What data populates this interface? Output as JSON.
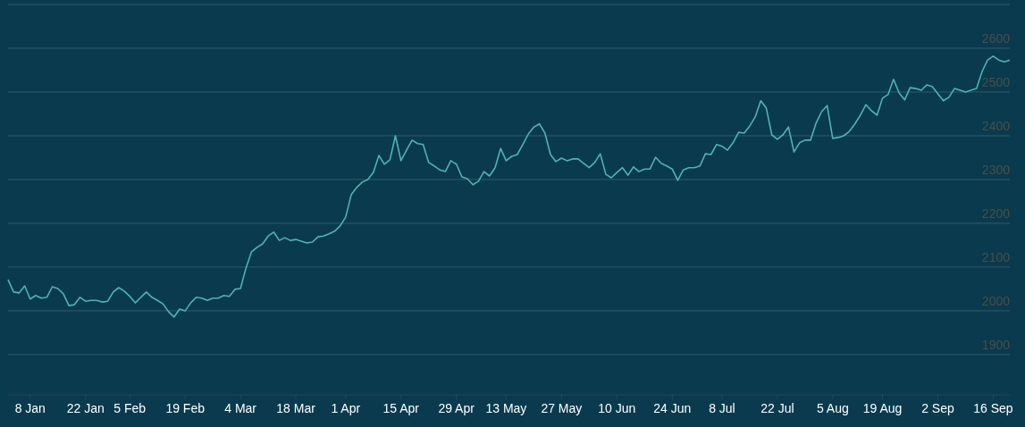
{
  "chart": {
    "chart_data": {
      "type": "line",
      "grid": true,
      "categories": [
        null,
        null,
        null,
        null,
        "8 Jan",
        null,
        null,
        null,
        null,
        null,
        null,
        null,
        null,
        null,
        "22 Jan",
        null,
        null,
        null,
        null,
        null,
        null,
        null,
        "5 Feb",
        null,
        null,
        null,
        null,
        null,
        null,
        null,
        null,
        null,
        "19 Feb",
        null,
        null,
        null,
        null,
        null,
        null,
        null,
        null,
        null,
        "4 Mar",
        null,
        null,
        null,
        null,
        null,
        null,
        null,
        null,
        null,
        "18 Mar",
        null,
        null,
        null,
        null,
        null,
        null,
        null,
        null,
        "1 Apr",
        null,
        null,
        null,
        null,
        null,
        null,
        null,
        null,
        null,
        "15 Apr",
        null,
        null,
        null,
        null,
        null,
        null,
        null,
        null,
        null,
        "29 Apr",
        null,
        null,
        null,
        null,
        null,
        null,
        null,
        null,
        "13 May",
        null,
        null,
        null,
        null,
        null,
        null,
        null,
        null,
        null,
        "27 May",
        null,
        null,
        null,
        null,
        null,
        null,
        null,
        null,
        null,
        "10 Jun",
        null,
        null,
        null,
        null,
        null,
        null,
        null,
        null,
        null,
        "24 Jun",
        null,
        null,
        null,
        null,
        null,
        null,
        null,
        null,
        "8 Jul",
        null,
        null,
        null,
        null,
        null,
        null,
        null,
        null,
        null,
        "22 Jul",
        null,
        null,
        null,
        null,
        null,
        null,
        null,
        null,
        null,
        "5 Aug",
        null,
        null,
        null,
        null,
        null,
        null,
        null,
        null,
        "19 Aug",
        null,
        null,
        null,
        null,
        null,
        null,
        null,
        null,
        null,
        "2 Sep",
        null,
        null,
        null,
        null,
        null,
        null,
        null,
        null,
        null,
        "16 Sep",
        null,
        null,
        null
      ],
      "series": [
        {
          "color": "#4fb3b5",
          "values": [
            2071,
            2043,
            2041,
            2057,
            2027,
            2035,
            2029,
            2031,
            2055,
            2051,
            2039,
            2012,
            2014,
            2031,
            2022,
            2024,
            2024,
            2020,
            2022,
            2043,
            2053,
            2045,
            2033,
            2018,
            2031,
            2043,
            2031,
            2024,
            2016,
            1998,
            1986,
            2004,
            2000,
            2018,
            2031,
            2029,
            2024,
            2029,
            2029,
            2035,
            2033,
            2049,
            2051,
            2098,
            2135,
            2145,
            2153,
            2171,
            2180,
            2161,
            2167,
            2161,
            2163,
            2159,
            2155,
            2157,
            2169,
            2171,
            2176,
            2182,
            2194,
            2214,
            2265,
            2282,
            2294,
            2300,
            2316,
            2355,
            2335,
            2345,
            2400,
            2343,
            2367,
            2390,
            2382,
            2380,
            2339,
            2331,
            2322,
            2318,
            2343,
            2335,
            2306,
            2302,
            2288,
            2296,
            2318,
            2308,
            2327,
            2371,
            2343,
            2353,
            2357,
            2380,
            2404,
            2420,
            2427,
            2406,
            2357,
            2341,
            2349,
            2343,
            2347,
            2347,
            2337,
            2327,
            2339,
            2359,
            2312,
            2304,
            2316,
            2327,
            2310,
            2329,
            2318,
            2324,
            2324,
            2351,
            2337,
            2331,
            2324,
            2298,
            2322,
            2327,
            2327,
            2331,
            2359,
            2357,
            2380,
            2376,
            2367,
            2384,
            2408,
            2406,
            2422,
            2443,
            2480,
            2463,
            2402,
            2392,
            2402,
            2420,
            2363,
            2384,
            2390,
            2390,
            2429,
            2455,
            2469,
            2394,
            2396,
            2400,
            2410,
            2427,
            2447,
            2471,
            2457,
            2447,
            2486,
            2494,
            2529,
            2498,
            2482,
            2510,
            2508,
            2504,
            2516,
            2512,
            2496,
            2480,
            2488,
            2508,
            2504,
            2500,
            2504,
            2508,
            2547,
            2573,
            2582,
            2573,
            2569,
            2573
          ]
        }
      ],
      "ylim": [
        1808,
        2700
      ],
      "yticks": [
        1900,
        2000,
        2100,
        2200,
        2300,
        2400,
        2500,
        2600
      ]
    }
  }
}
